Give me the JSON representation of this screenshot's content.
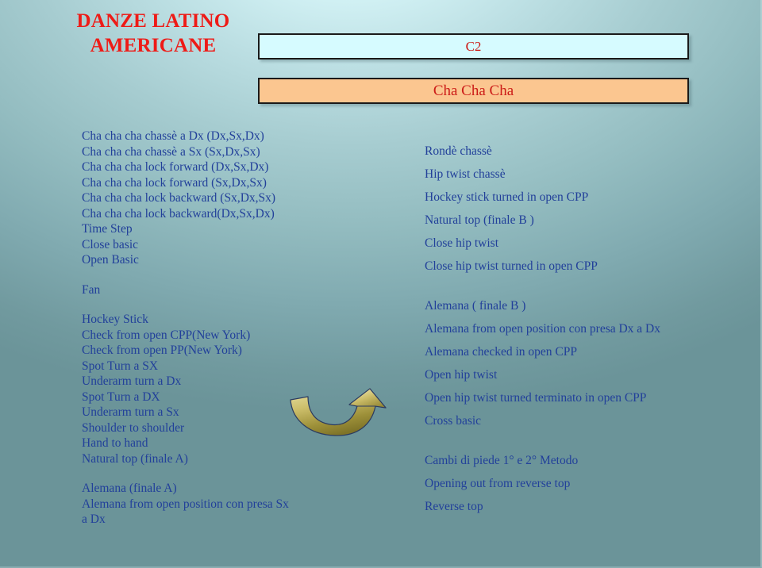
{
  "slide": {
    "title_lines": [
      "DANZE LATINO",
      "AMERICANE"
    ],
    "title_color": "#ee1b17",
    "text_color": "#22409a",
    "background_light": "#e2fbfd",
    "background_dark": "#6b9499"
  },
  "header": {
    "level_box": {
      "label": "C2",
      "fill": "#d6fbff",
      "text_color": "#cc1c18"
    },
    "dance_box": {
      "label": "Cha Cha Cha",
      "fill": "#fbc690",
      "text_color": "#cc1c18"
    }
  },
  "left_column": {
    "groups": [
      {
        "lines": [
          "Cha cha cha chassè a Dx (Dx,Sx,Dx)",
          "Cha cha cha chassè a Sx (Sx,Dx,Sx)",
          "Cha cha cha lock forward (Dx,Sx,Dx)",
          "Cha cha cha lock forward (Sx,Dx,Sx)",
          "Cha cha cha lock backward (Sx,Dx,Sx)",
          "Cha cha cha lock backward(Dx,Sx,Dx)",
          "Time Step",
          "Close basic",
          "Open Basic"
        ]
      },
      {
        "lines": [
          "Fan"
        ]
      },
      {
        "lines": [
          "Hockey Stick",
          "Check from open CPP(New York)",
          "Check from open PP(New York)",
          "Spot Turn a SX",
          "Underarm turn a Dx",
          "Spot Turn a DX",
          "Underarm turn a Sx",
          "Shoulder to shoulder",
          "Hand to hand",
          "Natural top (finale A)"
        ]
      },
      {
        "lines": [
          "Alemana (finale A)",
          "Alemana from open position con presa Sx",
          "a Dx"
        ]
      }
    ]
  },
  "right_column": {
    "groups": [
      {
        "lines": [
          "Rondè chassè",
          "Hip twist chassè",
          "Hockey stick turned in open CPP",
          "Natural top (finale B )",
          "Close hip twist",
          "Close hip twist turned in open CPP"
        ]
      },
      {
        "lines": [
          "Alemana ( finale B )",
          "Alemana from open position con presa Dx a Dx",
          "Alemana checked in open CPP",
          "Open hip twist",
          "Open hip twist turned terminato in open CPP",
          "Cross basic"
        ]
      },
      {
        "lines": [
          "Cambi di piede 1° e 2° Metodo",
          "Opening out from reverse top",
          "Reverse top"
        ]
      }
    ]
  },
  "decoration": {
    "arrow": {
      "name": "curved-up-right-arrow",
      "fill_light": "#e8dfa0",
      "fill_dark": "#8f8330",
      "stroke": "#2d3a5e"
    }
  }
}
